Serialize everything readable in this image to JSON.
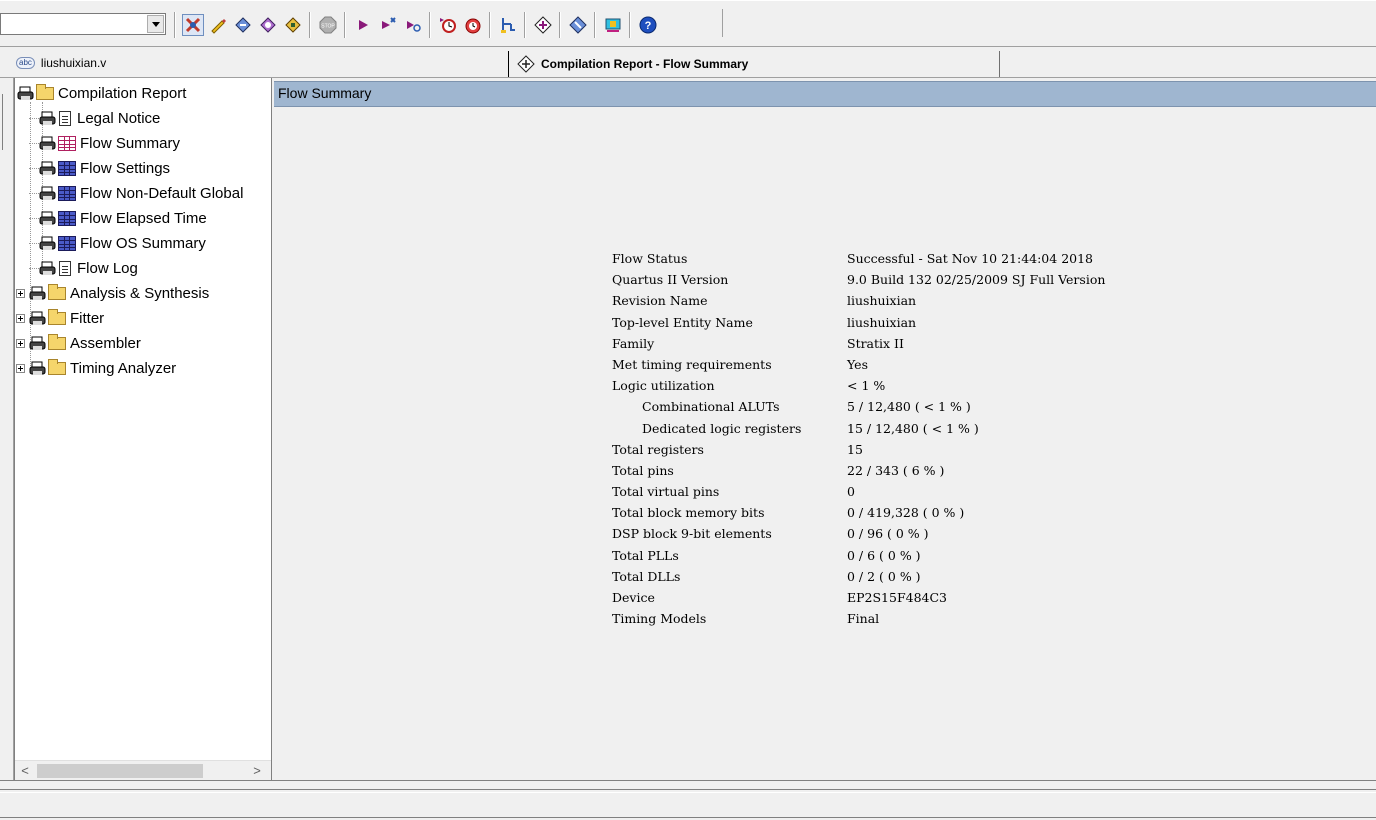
{
  "toolbar": {
    "combo_value": "",
    "icons": [
      "compile-x-icon",
      "pencil-icon",
      "analysis-icon",
      "synthesis-icon",
      "fitter-icon",
      "stop-icon",
      "play-icon",
      "timing-icon",
      "step-icon",
      "timer-icon",
      "clock-icon",
      "netlist-icon",
      "rtl-icon",
      "programmer-icon",
      "chip-icon",
      "help-icon"
    ]
  },
  "tabs": {
    "file_tab": "liushuixian.v",
    "file_tab_badge": "abc",
    "report_tab": "Compilation Report - Flow Summary"
  },
  "tree": {
    "root": "Compilation Report",
    "items": [
      {
        "label": "Legal Notice",
        "icon": "document"
      },
      {
        "label": "Flow Summary",
        "icon": "table-selected"
      },
      {
        "label": "Flow Settings",
        "icon": "table"
      },
      {
        "label": "Flow Non-Default Global",
        "icon": "table"
      },
      {
        "label": "Flow Elapsed Time",
        "icon": "table"
      },
      {
        "label": "Flow OS Summary",
        "icon": "table"
      },
      {
        "label": "Flow Log",
        "icon": "document"
      },
      {
        "label": "Analysis & Synthesis",
        "icon": "folder"
      },
      {
        "label": "Fitter",
        "icon": "folder"
      },
      {
        "label": "Assembler",
        "icon": "folder"
      },
      {
        "label": "Timing Analyzer",
        "icon": "folder"
      }
    ]
  },
  "report": {
    "header": "Flow Summary",
    "rows": [
      {
        "key": "Flow Status",
        "value": "Successful - Sat Nov 10 21:44:04 2018"
      },
      {
        "key": "Quartus II Version",
        "value": "9.0 Build 132 02/25/2009 SJ Full Version"
      },
      {
        "key": "Revision Name",
        "value": "liushuixian"
      },
      {
        "key": "Top-level Entity Name",
        "value": "liushuixian"
      },
      {
        "key": "Family",
        "value": "Stratix II"
      },
      {
        "key": "Met timing requirements",
        "value": "Yes"
      },
      {
        "key": "Logic utilization",
        "value": "< 1 %"
      },
      {
        "key": "Combinational ALUTs",
        "value": "5 / 12,480 ( < 1 % )",
        "indent": true
      },
      {
        "key": "Dedicated logic registers",
        "value": "15 / 12,480 ( < 1 % )",
        "indent": true
      },
      {
        "key": "Total registers",
        "value": "15"
      },
      {
        "key": "Total pins",
        "value": "22 / 343 ( 6 % )"
      },
      {
        "key": "Total virtual pins",
        "value": "0"
      },
      {
        "key": "Total block memory bits",
        "value": "0 / 419,328 ( 0 % )"
      },
      {
        "key": "DSP block 9-bit elements",
        "value": "0 / 96 ( 0 % )"
      },
      {
        "key": "Total PLLs",
        "value": "0 / 6 ( 0 % )"
      },
      {
        "key": "Total DLLs",
        "value": "0 / 2 ( 0 % )"
      },
      {
        "key": "Device",
        "value": "EP2S15F484C3"
      },
      {
        "key": "Timing Models",
        "value": "Final"
      }
    ]
  },
  "scrollbar": {
    "left_arrow": "<",
    "right_arrow": ">"
  }
}
